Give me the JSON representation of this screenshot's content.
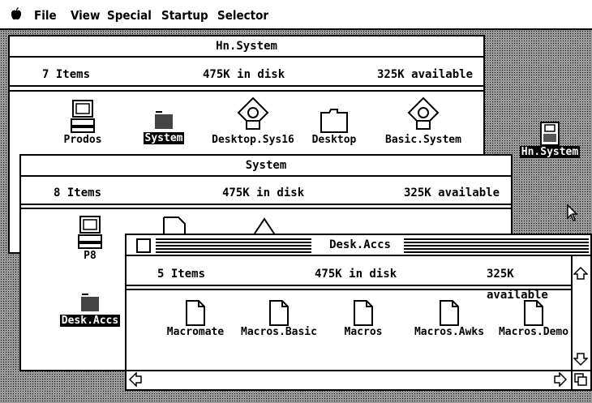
{
  "menubar": {
    "apple_icon": "apple-icon",
    "items": [
      "File",
      "View",
      "Special",
      "Startup",
      "Selector"
    ]
  },
  "desktop": {
    "volume_icon_label": "Hn.System"
  },
  "win_hn": {
    "title": "Hn.System",
    "items_count": "7 Items",
    "in_disk": "475K in disk",
    "available": "325K available",
    "icons": [
      "Prodos",
      "System",
      "Desktop.Sys16",
      "Desktop",
      "Basic.System"
    ]
  },
  "win_system": {
    "title": "System",
    "items_count": "8 Items",
    "in_disk": "475K in disk",
    "available": "325K available",
    "icons": [
      "P8",
      "Desk.Accs"
    ]
  },
  "win_desk": {
    "title": "Desk.Accs",
    "items_count": "5 Items",
    "in_disk": "475K in disk",
    "available": "325K available",
    "icons": [
      "Macromate",
      "Macros.Basic",
      "Macros",
      "Macros.Awks",
      "Macros.Demo"
    ]
  }
}
